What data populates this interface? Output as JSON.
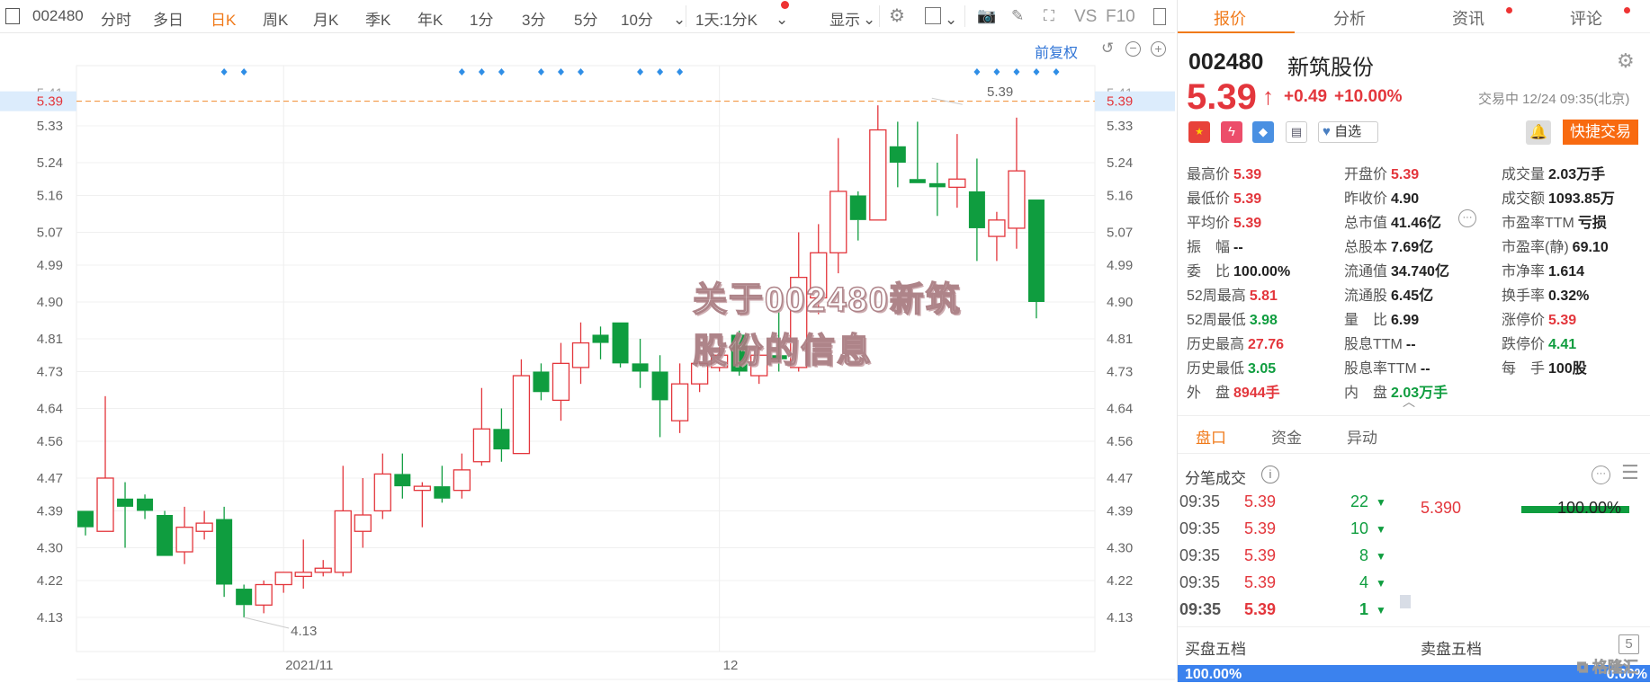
{
  "toolbar": {
    "code": "002480",
    "periods": [
      "分时",
      "多日",
      "日K",
      "周K",
      "月K",
      "季K",
      "年K",
      "1分",
      "3分",
      "5分",
      "10分"
    ],
    "active_period": "日K",
    "interval_select": "1天:1分K",
    "display_label": "显示",
    "vs_label": "VS",
    "f10_label": "F10"
  },
  "chart_sub": {
    "adjust_label": "前复权"
  },
  "chart_data": {
    "type": "candlestick",
    "fields": [
      "open",
      "high",
      "low",
      "close"
    ],
    "candles": [
      [
        4.39,
        4.39,
        4.33,
        4.35
      ],
      [
        4.34,
        4.67,
        4.34,
        4.47
      ],
      [
        4.42,
        4.46,
        4.3,
        4.4
      ],
      [
        4.42,
        4.43,
        4.37,
        4.39
      ],
      [
        4.38,
        4.39,
        4.28,
        4.28
      ],
      [
        4.29,
        4.4,
        4.26,
        4.35
      ],
      [
        4.34,
        4.39,
        4.32,
        4.36
      ],
      [
        4.37,
        4.4,
        4.18,
        4.21
      ],
      [
        4.2,
        4.21,
        4.13,
        4.16
      ],
      [
        4.16,
        4.22,
        4.14,
        4.21
      ],
      [
        4.21,
        4.24,
        4.19,
        4.24
      ],
      [
        4.23,
        4.32,
        4.2,
        4.24
      ],
      [
        4.24,
        4.27,
        4.23,
        4.25
      ],
      [
        4.24,
        4.5,
        4.23,
        4.39
      ],
      [
        4.34,
        4.47,
        4.3,
        4.38
      ],
      [
        4.39,
        4.53,
        4.37,
        4.48
      ],
      [
        4.48,
        4.53,
        4.42,
        4.45
      ],
      [
        4.44,
        4.46,
        4.35,
        4.45
      ],
      [
        4.45,
        4.5,
        4.41,
        4.42
      ],
      [
        4.44,
        4.53,
        4.42,
        4.49
      ],
      [
        4.51,
        4.69,
        4.5,
        4.59
      ],
      [
        4.59,
        4.64,
        4.51,
        4.54
      ],
      [
        4.53,
        4.76,
        4.53,
        4.72
      ],
      [
        4.73,
        4.75,
        4.66,
        4.68
      ],
      [
        4.66,
        4.8,
        4.61,
        4.75
      ],
      [
        4.74,
        4.85,
        4.7,
        4.8
      ],
      [
        4.82,
        4.84,
        4.76,
        4.8
      ],
      [
        4.85,
        4.85,
        4.74,
        4.75
      ],
      [
        4.75,
        4.81,
        4.69,
        4.73
      ],
      [
        4.73,
        4.77,
        4.57,
        4.66
      ],
      [
        4.61,
        4.75,
        4.58,
        4.7
      ],
      [
        4.7,
        4.77,
        4.68,
        4.75
      ],
      [
        4.74,
        4.79,
        4.73,
        4.77
      ],
      [
        4.82,
        4.83,
        4.72,
        4.73
      ],
      [
        4.72,
        4.79,
        4.7,
        4.77
      ],
      [
        4.77,
        4.88,
        4.73,
        4.76
      ],
      [
        4.74,
        5.07,
        4.73,
        4.96
      ],
      [
        4.91,
        5.09,
        4.87,
        5.02
      ],
      [
        5.02,
        5.3,
        4.97,
        5.17
      ],
      [
        5.16,
        5.17,
        5.05,
        5.1
      ],
      [
        5.1,
        5.38,
        5.1,
        5.32
      ],
      [
        5.28,
        5.34,
        5.18,
        5.24
      ],
      [
        5.2,
        5.34,
        5.19,
        5.19
      ],
      [
        5.19,
        5.24,
        5.11,
        5.18
      ],
      [
        5.18,
        5.31,
        5.13,
        5.2
      ],
      [
        5.17,
        5.25,
        5.0,
        5.08
      ],
      [
        5.06,
        5.12,
        5.0,
        5.1
      ],
      [
        5.08,
        5.35,
        5.03,
        5.22
      ],
      [
        5.15,
        5.15,
        4.86,
        4.9
      ]
    ],
    "y_ticks": [
      "5.41",
      "5.33",
      "5.24",
      "5.16",
      "5.07",
      "4.99",
      "4.90",
      "4.81",
      "4.73",
      "4.64",
      "4.56",
      "4.47",
      "4.39",
      "4.30",
      "4.22",
      "4.13"
    ],
    "y_tick_values": [
      5.41,
      5.33,
      5.24,
      5.16,
      5.07,
      4.99,
      4.9,
      4.81,
      4.73,
      4.64,
      4.56,
      4.47,
      4.39,
      4.3,
      4.22,
      4.13
    ],
    "current_price_line": {
      "value": 5.39,
      "label": "5.39"
    },
    "max_label": "5.39",
    "min_label": "4.13",
    "x_labels": [
      {
        "label": "2021/11",
        "candle": 11
      },
      {
        "label": "12",
        "candle": 33
      }
    ],
    "event_markers": [
      8,
      9,
      20,
      21,
      22,
      24,
      25,
      26,
      29,
      30,
      31,
      46,
      47,
      48,
      49,
      50
    ],
    "colors": {
      "up": "#e3363c",
      "down": "#0f9d3f",
      "marker": "#2f8ee6",
      "price_line": "#f08a2c"
    },
    "grid": true
  },
  "watermark": {
    "line1": "关于002480新筑",
    "line2": "股份的信息"
  },
  "panel": {
    "tabs": [
      {
        "label": "报价",
        "dot": false
      },
      {
        "label": "分析",
        "dot": false
      },
      {
        "label": "资讯",
        "dot": true
      },
      {
        "label": "评论",
        "dot": true
      }
    ],
    "code": "002480",
    "name": "新筑股份",
    "price": "5.39",
    "change": "+0.49",
    "change_pct": "+10.00%",
    "status": "交易中 12/24 09:35(北京)",
    "watch_label": "自选",
    "trade_button": "快捷交易",
    "stats": [
      [
        [
          "最高价",
          "5.39",
          "red"
        ],
        [
          "开盘价",
          "5.39",
          "red"
        ],
        [
          "成交量",
          "2.03万手",
          "dark"
        ]
      ],
      [
        [
          "最低价",
          "5.39",
          "red"
        ],
        [
          "昨收价",
          "4.90",
          "dark"
        ],
        [
          "成交额",
          "1093.85万",
          "dark"
        ]
      ],
      [
        [
          "平均价",
          "5.39",
          "red"
        ],
        [
          "总市值",
          "41.46亿",
          "dark"
        ],
        [
          "市盈率TTM",
          "亏损",
          "dark"
        ]
      ],
      [
        [
          "振　幅",
          "--",
          "dark"
        ],
        [
          "总股本",
          "7.69亿",
          "dark"
        ],
        [
          "市盈率(静)",
          "69.10",
          "dark"
        ]
      ],
      [
        [
          "委　比",
          "100.00%",
          "dark"
        ],
        [
          "流通值",
          "34.740亿",
          "dark"
        ],
        [
          "市净率",
          "1.614",
          "dark"
        ]
      ],
      [
        [
          "52周最高",
          "5.81",
          "red"
        ],
        [
          "流通股",
          "6.45亿",
          "dark"
        ],
        [
          "换手率",
          "0.32%",
          "dark"
        ]
      ],
      [
        [
          "52周最低",
          "3.98",
          "green"
        ],
        [
          "量　比",
          "6.99",
          "dark"
        ],
        [
          "涨停价",
          "5.39",
          "red"
        ]
      ],
      [
        [
          "历史最高",
          "27.76",
          "red"
        ],
        [
          "股息TTM",
          "--",
          "dark"
        ],
        [
          "跌停价",
          "4.41",
          "green"
        ]
      ],
      [
        [
          "历史最低",
          "3.05",
          "green"
        ],
        [
          "股息率TTM",
          "--",
          "dark"
        ],
        [
          "每　手",
          "100股",
          "dark"
        ]
      ],
      [
        [
          "外　盘",
          "8944手",
          "red"
        ],
        [
          "内　盘",
          "2.03万手",
          "green"
        ],
        null
      ]
    ],
    "sub_tabs": [
      "盘口",
      "资金",
      "异动"
    ],
    "ticks_title": "分笔成交",
    "ticks": [
      [
        "09:35",
        "5.39",
        "22"
      ],
      [
        "09:35",
        "5.39",
        "10"
      ],
      [
        "09:35",
        "5.39",
        "8"
      ],
      [
        "09:35",
        "5.39",
        "4"
      ],
      [
        "09:35",
        "5.39",
        "1"
      ]
    ],
    "price_dist": {
      "price": "5.390",
      "pct": "100.00%",
      "fraction": 1.0
    },
    "bid_title": "买盘五档",
    "ask_title": "卖盘五档",
    "level_badge": "5",
    "bid_pct": "100.00%",
    "ask_pct": "0.00%",
    "logo_text": "格隆汇"
  }
}
